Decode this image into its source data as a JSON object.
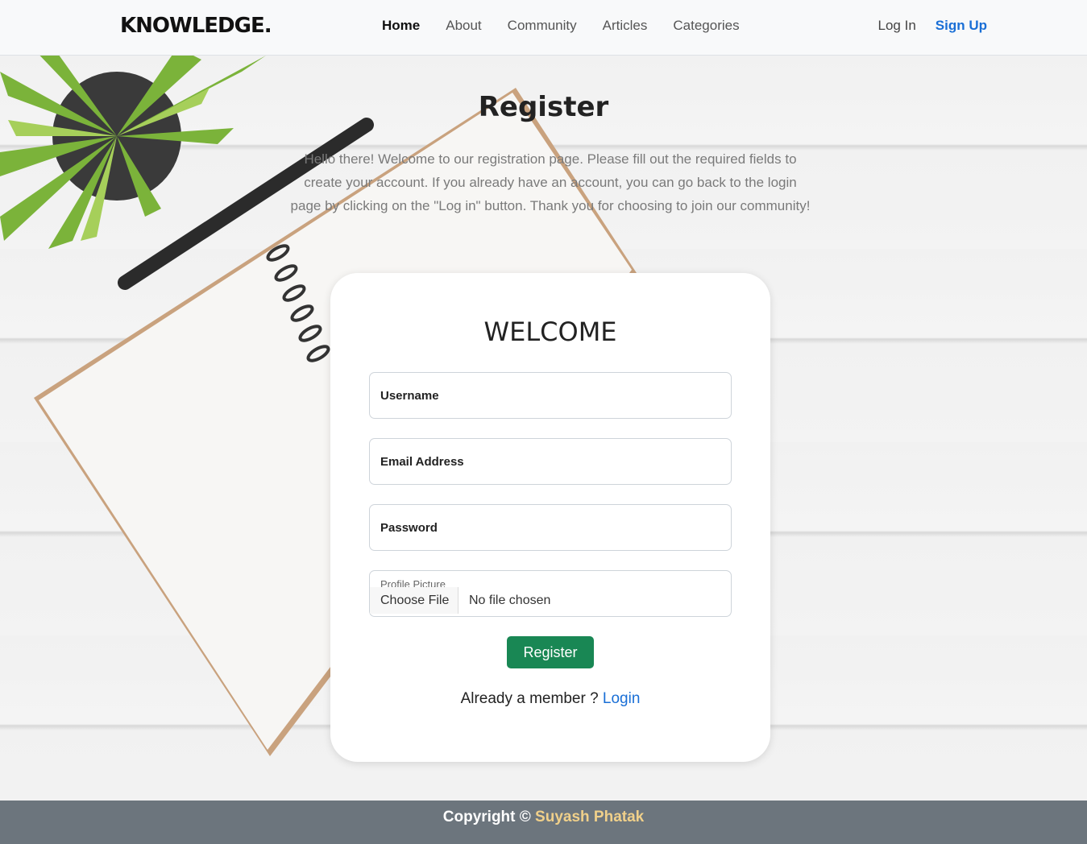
{
  "nav": {
    "brand": "KNOWLEDGE.",
    "links": [
      "Home",
      "About",
      "Community",
      "Articles",
      "Categories"
    ],
    "login": "Log In",
    "signup": "Sign Up"
  },
  "hero": {
    "title": "Register",
    "description": "Hello there! Welcome to our registration page. Please fill out the required fields to create your account. If you already have an account, you can go back to the login page by clicking on the \"Log in\" button. Thank you for choosing to join our community!"
  },
  "form": {
    "heading": "WELCOME",
    "username_label": "Username",
    "email_label": "Email Address",
    "password_label": "Password",
    "profile_label": "Profile Picture",
    "choose_file": "Choose File",
    "no_file": "No file chosen",
    "submit": "Register",
    "member_text": "Already a member ?",
    "login_link": "Login"
  },
  "footer": {
    "prefix": "Copyright ©",
    "author": "Suyash Phatak"
  },
  "colors": {
    "accent": "#1a6fd6",
    "button": "#198754",
    "footer": "#6c757d",
    "author": "#f0d08a"
  }
}
